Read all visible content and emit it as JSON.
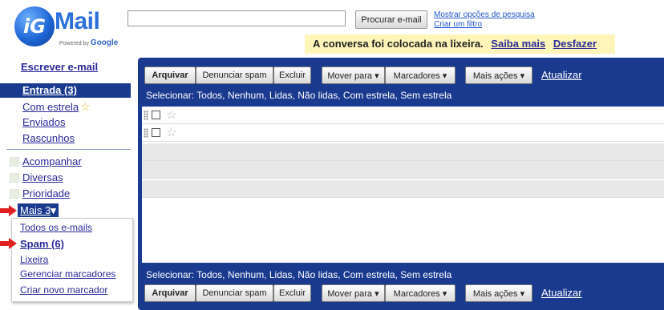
{
  "header": {
    "logo_badge": "iG",
    "logo_text": "Mail",
    "logo_powered": "Powered by",
    "logo_powered_brand": "Google",
    "search_value": "",
    "search_button": "Procurar e-mail",
    "show_search_options": "Mostrar opções de pesquisa",
    "create_filter": "Criar um filtro"
  },
  "notice": {
    "message": "A conversa foi colocada na lixeira.",
    "learn_more": "Saiba mais",
    "undo": "Desfazer"
  },
  "sidebar": {
    "compose": "Escrever e-mail",
    "inbox": "Entrada (3)",
    "starred": "Com estrela",
    "sent": "Enviados",
    "drafts": "Rascunhos",
    "labels": [
      "Acompanhar",
      "Diversas",
      "Prioridade"
    ],
    "more": "Mais 3",
    "more_caret": "▾",
    "dropdown": {
      "all_mail": "Todos os e-mails",
      "spam": "Spam (6)",
      "trash": "Lixeira",
      "manage_labels": "Gerenciar marcadores",
      "create_label": "Criar novo marcador"
    }
  },
  "toolbar": {
    "archive": "Arquivar",
    "report_spam": "Denunciar spam",
    "delete": "Excluir",
    "move_to": "Mover para ▾",
    "labels": "Marcadores ▾",
    "more_actions": "Mais ações ▾",
    "refresh": "Atualizar"
  },
  "select_bar": "Selecionar: Todos, Nenhum, Lidas, Não lidas, Com estrela, Sem estrela",
  "messages": {
    "row_count": 5
  },
  "colors": {
    "panel_blue": "#1a3a8f",
    "notice_yellow": "#fef5b8",
    "star_gold": "#e7b928",
    "arrow_red": "#e02020"
  }
}
